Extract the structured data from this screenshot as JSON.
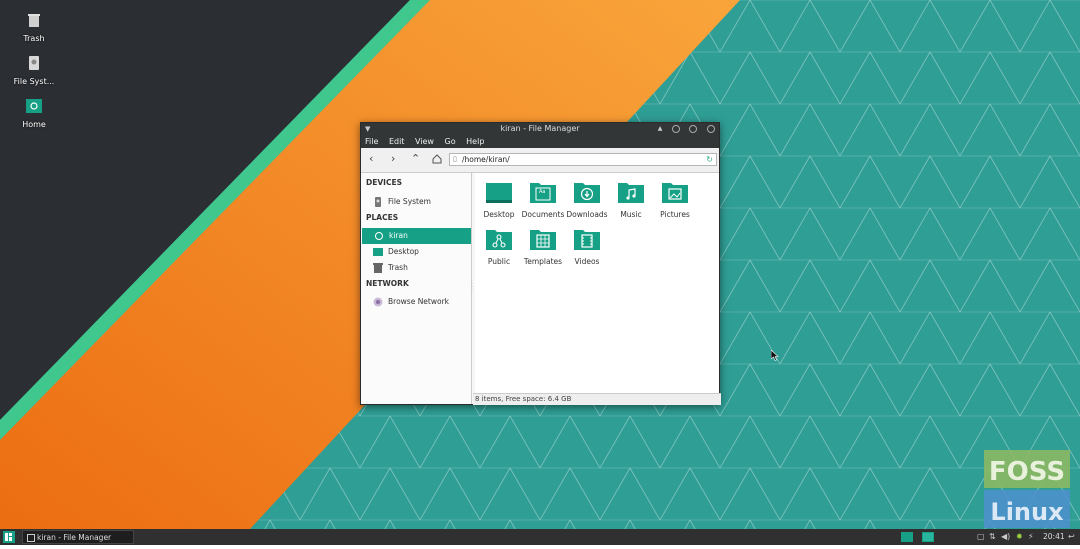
{
  "desktop": {
    "icons": [
      {
        "label": "Trash",
        "icon": "trash-icon"
      },
      {
        "label": "File Syst...",
        "icon": "drive-icon"
      },
      {
        "label": "Home",
        "icon": "home-folder-icon"
      }
    ]
  },
  "window": {
    "title": "kiran - File Manager",
    "menu": [
      "File",
      "Edit",
      "View",
      "Go",
      "Help"
    ],
    "path": "/home/kiran/",
    "sidebar": {
      "devices_heading": "DEVICES",
      "devices": [
        {
          "label": "File System",
          "icon": "drive-icon"
        }
      ],
      "places_heading": "PLACES",
      "places": [
        {
          "label": "kiran",
          "icon": "home-icon",
          "active": true
        },
        {
          "label": "Desktop",
          "icon": "desktop-icon"
        },
        {
          "label": "Trash",
          "icon": "trash-icon"
        }
      ],
      "network_heading": "NETWORK",
      "network": [
        {
          "label": "Browse Network",
          "icon": "network-icon"
        }
      ]
    },
    "files": [
      {
        "label": "Desktop",
        "icon": "desktop-folder-icon"
      },
      {
        "label": "Documents",
        "icon": "documents-folder-icon"
      },
      {
        "label": "Downloads",
        "icon": "downloads-folder-icon"
      },
      {
        "label": "Music",
        "icon": "music-folder-icon"
      },
      {
        "label": "Pictures",
        "icon": "pictures-folder-icon"
      },
      {
        "label": "Public",
        "icon": "public-folder-icon"
      },
      {
        "label": "Templates",
        "icon": "templates-folder-icon"
      },
      {
        "label": "Videos",
        "icon": "videos-folder-icon"
      }
    ],
    "status": "8 items, Free space: 6.4 GB"
  },
  "watermark": {
    "line1": "FOSS",
    "line2": "Linux"
  },
  "taskbar": {
    "task_label": "kiran - File Manager",
    "clock": "20:41"
  },
  "colors": {
    "accent": "#16a085",
    "orange": "#f07c1f",
    "teal": "#2f9b93",
    "dark": "#2b2e33"
  }
}
